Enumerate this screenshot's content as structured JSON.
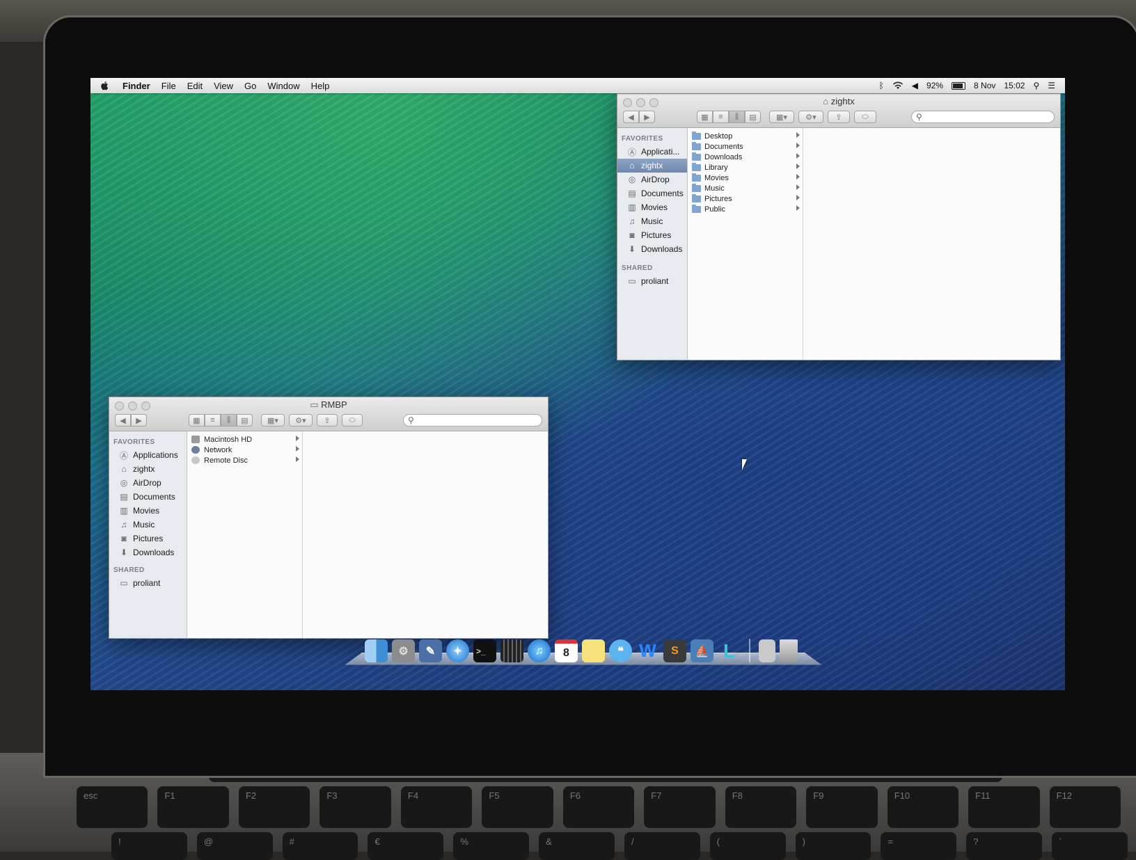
{
  "menubar": {
    "app_name": "Finder",
    "menus": [
      "File",
      "Edit",
      "View",
      "Go",
      "Window",
      "Help"
    ],
    "battery": "92%",
    "date": "8 Nov",
    "time": "15:02"
  },
  "window_home": {
    "title": "zightx",
    "sidebar": {
      "favorites_header": "FAVORITES",
      "favorites": [
        "Applicati...",
        "zightx",
        "AirDrop",
        "Documents",
        "Movies",
        "Music",
        "Pictures",
        "Downloads"
      ],
      "selected": "zightx",
      "shared_header": "SHARED",
      "shared": [
        "proliant"
      ]
    },
    "column1": [
      "Desktop",
      "Documents",
      "Downloads",
      "Library",
      "Movies",
      "Music",
      "Pictures",
      "Public"
    ]
  },
  "window_rmbp": {
    "title": "RMBP",
    "sidebar": {
      "favorites_header": "FAVORITES",
      "favorites": [
        "Applications",
        "zightx",
        "AirDrop",
        "Documents",
        "Movies",
        "Music",
        "Pictures",
        "Downloads"
      ],
      "shared_header": "SHARED",
      "shared": [
        "proliant"
      ]
    },
    "column1": [
      "Macintosh HD",
      "Network",
      "Remote Disc"
    ]
  },
  "dock": {
    "calendar_day": "8",
    "sublime_letter": "S",
    "word_letter": "W",
    "last_letter": "L"
  },
  "keyboard": {
    "fn_row": [
      "esc",
      "F1",
      "F2",
      "F3",
      "F4",
      "F5",
      "F6",
      "F7",
      "F8",
      "F9",
      "F10",
      "F11",
      "F12"
    ],
    "num_row": [
      "!",
      "@",
      "#",
      "€",
      "%",
      "&",
      "/",
      "(",
      ")",
      "=",
      "?",
      "`"
    ]
  },
  "colors": {
    "selection": "#7289ad",
    "folder": "#7fa6d1"
  }
}
